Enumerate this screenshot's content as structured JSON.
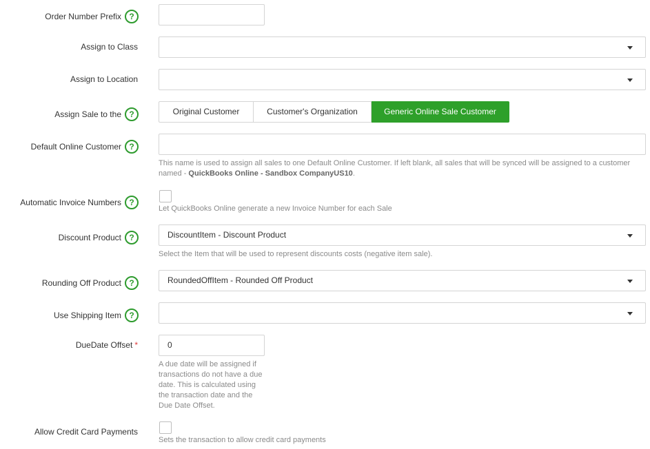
{
  "fields": {
    "order_prefix": {
      "label": "Order Number Prefix",
      "value": ""
    },
    "assign_class": {
      "label": "Assign to Class",
      "value": ""
    },
    "assign_location": {
      "label": "Assign to Location",
      "value": ""
    },
    "assign_sale": {
      "label": "Assign Sale to the",
      "options": [
        "Original Customer",
        "Customer's Organization",
        "Generic Online Sale Customer"
      ],
      "selected": "Generic Online Sale Customer"
    },
    "default_customer": {
      "label": "Default Online Customer",
      "value": "",
      "hint_line1": "This name is used to assign all sales to one Default Online Customer. If left blank, all sales that will be synced will be assigned to a customer",
      "hint_prefix": "named - ",
      "hint_name": "QuickBooks Online - Sandbox CompanyUS10",
      "hint_suffix": "."
    },
    "auto_invoice": {
      "label": "Automatic Invoice Numbers",
      "checked": false,
      "hint": "Let QuickBooks Online generate a new Invoice Number for each Sale"
    },
    "discount_product": {
      "label": "Discount Product",
      "value": "DiscountItem - Discount Product",
      "hint": "Select the Item that will be used to represent discounts costs (negative item sale)."
    },
    "rounding_product": {
      "label": "Rounding Off Product",
      "value": "RoundedOffItem - Rounded Off Product"
    },
    "shipping_item": {
      "label": "Use Shipping Item",
      "value": ""
    },
    "due_date_offset": {
      "label": "DueDate Offset",
      "required_mark": "*",
      "value": "0",
      "hint_lines": [
        "A due date will be assigned if",
        "transactions do not have a due",
        "date. This is calculated using",
        "the transaction date and the",
        "Due Date Offset."
      ]
    },
    "credit_card": {
      "label": "Allow Credit Card Payments",
      "checked": false,
      "hint": "Sets the transaction to allow credit card payments"
    }
  },
  "icons": {
    "help": "question-circle-icon",
    "dropdown": "chevron-down-icon"
  },
  "colors": {
    "accent": "#2ea02a",
    "help": "#2e9b2e",
    "required": "#e03b3b"
  }
}
